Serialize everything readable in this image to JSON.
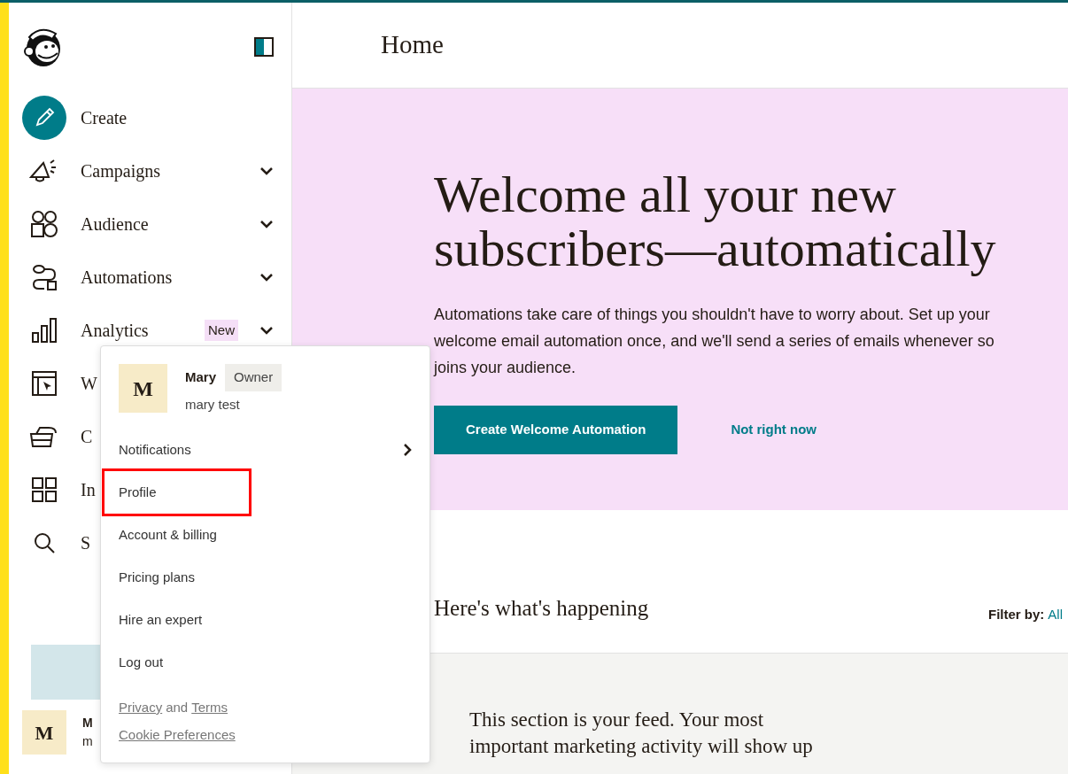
{
  "sidebar": {
    "items": [
      {
        "label": "Create",
        "kind": "create",
        "has_menu": false
      },
      {
        "label": "Campaigns",
        "kind": "nav",
        "has_menu": true
      },
      {
        "label": "Audience",
        "kind": "nav",
        "has_menu": true
      },
      {
        "label": "Automations",
        "kind": "nav",
        "has_menu": true
      },
      {
        "label": "Analytics",
        "kind": "nav",
        "has_menu": true,
        "badge": "New"
      },
      {
        "label": "W",
        "kind": "nav",
        "has_menu": false
      },
      {
        "label": "C",
        "kind": "nav",
        "has_menu": false
      },
      {
        "label": "In",
        "kind": "nav",
        "has_menu": false
      },
      {
        "label": "S",
        "kind": "nav",
        "has_menu": false
      }
    ],
    "account": {
      "avatar_letter": "M",
      "name": "M",
      "subtitle": "m"
    }
  },
  "header": {
    "title": "Home"
  },
  "hero": {
    "title_lines": [
      "Welcome all your new",
      "subscribers—automatically"
    ],
    "text_lines": [
      "Automations take care of things you shouldn't have to worry about. Set up your",
      "welcome email automation once, and we'll send a series of emails whenever so",
      "joins your audience."
    ],
    "primary_button": "Create Welcome Automation",
    "secondary_link": "Not right now"
  },
  "feed": {
    "title": "Here's what's happening",
    "filter_label": "Filter by:",
    "filter_value": "All",
    "intro_lines": [
      "This section is your feed. Your most",
      "important marketing activity will show up"
    ]
  },
  "account_menu": {
    "avatar_letter": "M",
    "name": "Mary",
    "role": "Owner",
    "username": "mary test",
    "items": [
      {
        "label": "Notifications",
        "kind": "submenu",
        "highlighted": false
      },
      {
        "label": "Profile",
        "kind": "link",
        "highlighted": true
      },
      {
        "label": "Account & billing",
        "kind": "link",
        "highlighted": false
      },
      {
        "label": "Pricing plans",
        "kind": "link",
        "highlighted": false
      },
      {
        "label": "Hire an expert",
        "kind": "link",
        "highlighted": false
      },
      {
        "label": "Log out",
        "kind": "link",
        "highlighted": false
      }
    ],
    "footer_links": [
      {
        "label": "Privacy",
        "joiner": "and"
      },
      {
        "label": "Terms"
      }
    ],
    "cookie_link": "Cookie Preferences"
  }
}
